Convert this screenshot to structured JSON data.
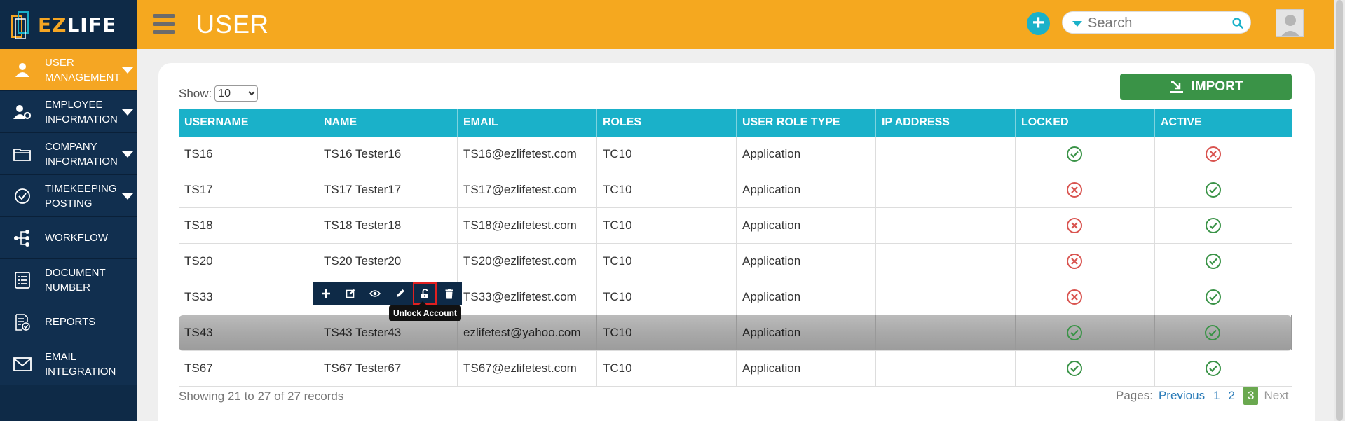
{
  "app": {
    "logo_ez": "EZ",
    "logo_life": "LIFE",
    "page_title": "USER"
  },
  "sidebar": {
    "items": [
      {
        "label_line1": "USER",
        "label_line2": "MANAGEMENT",
        "icon": "user-icon",
        "active": true,
        "has_caret": true
      },
      {
        "label_line1": "EMPLOYEE",
        "label_line2": "INFORMATION",
        "icon": "user-cog-icon",
        "active": false,
        "has_caret": true
      },
      {
        "label_line1": "COMPANY",
        "label_line2": "INFORMATION",
        "icon": "folder-icon",
        "active": false,
        "has_caret": true
      },
      {
        "label_line1": "TIMEKEEPING",
        "label_line2": "POSTING",
        "icon": "check-circle-icon",
        "active": false,
        "has_caret": true
      },
      {
        "label_line1": "WORKFLOW",
        "label_line2": "",
        "icon": "workflow-icon",
        "active": false,
        "has_caret": false
      },
      {
        "label_line1": "DOCUMENT",
        "label_line2": "NUMBER",
        "icon": "document-list-icon",
        "active": false,
        "has_caret": false
      },
      {
        "label_line1": "REPORTS",
        "label_line2": "",
        "icon": "report-icon",
        "active": false,
        "has_caret": false
      },
      {
        "label_line1": "EMAIL",
        "label_line2": "INTEGRATION",
        "icon": "envelope-icon",
        "active": false,
        "has_caret": false
      }
    ]
  },
  "header": {
    "search_placeholder": "Search",
    "add_label": "+"
  },
  "controls": {
    "show_label": "Show:",
    "show_value": "10",
    "import_label": "IMPORT"
  },
  "table": {
    "columns": [
      "USERNAME",
      "NAME",
      "EMAIL",
      "ROLES",
      "USER ROLE TYPE",
      "IP ADDRESS",
      "LOCKED",
      "ACTIVE"
    ],
    "rows": [
      {
        "username": "TS16",
        "name": "TS16 Tester16",
        "email": "TS16@ezlifetest.com",
        "roles": "TC10",
        "role_type": "Application",
        "ip": "",
        "locked": true,
        "active": false
      },
      {
        "username": "TS17",
        "name": "TS17 Tester17",
        "email": "TS17@ezlifetest.com",
        "roles": "TC10",
        "role_type": "Application",
        "ip": "",
        "locked": false,
        "active": true
      },
      {
        "username": "TS18",
        "name": "TS18 Tester18",
        "email": "TS18@ezlifetest.com",
        "roles": "TC10",
        "role_type": "Application",
        "ip": "",
        "locked": false,
        "active": true
      },
      {
        "username": "TS20",
        "name": "TS20 Tester20",
        "email": "TS20@ezlifetest.com",
        "roles": "TC10",
        "role_type": "Application",
        "ip": "",
        "locked": false,
        "active": true
      },
      {
        "username": "TS33",
        "name": "",
        "email": "TS33@ezlifetest.com",
        "roles": "TC10",
        "role_type": "Application",
        "ip": "",
        "locked": false,
        "active": true
      },
      {
        "username": "TS43",
        "name": "TS43 Tester43",
        "email": "ezlifetest@yahoo.com",
        "roles": "TC10",
        "role_type": "Application",
        "ip": "",
        "locked": true,
        "active": true,
        "highlight": true
      },
      {
        "username": "TS67",
        "name": "TS67 Tester67",
        "email": "TS67@ezlifetest.com",
        "roles": "TC10",
        "role_type": "Application",
        "ip": "",
        "locked": true,
        "active": true
      }
    ]
  },
  "toolbar": {
    "tools": [
      "plus-icon",
      "edit-icon",
      "eye-icon",
      "pencil-icon",
      "unlock-icon",
      "trash-icon"
    ],
    "tooltip": "Unlock Account"
  },
  "footer": {
    "showing_text": "Showing 21 to 27 of 27 records",
    "pages_label": "Pages:",
    "previous": "Previous",
    "pages": [
      "1",
      "2",
      "3"
    ],
    "current_page": "3",
    "next": "Next"
  },
  "colors": {
    "header": "#f5a81f",
    "sidebar": "#0e2a47",
    "table_header": "#1ab1c9",
    "import_button": "#3a9347",
    "ok": "#3a9347",
    "no": "#d9534f"
  }
}
